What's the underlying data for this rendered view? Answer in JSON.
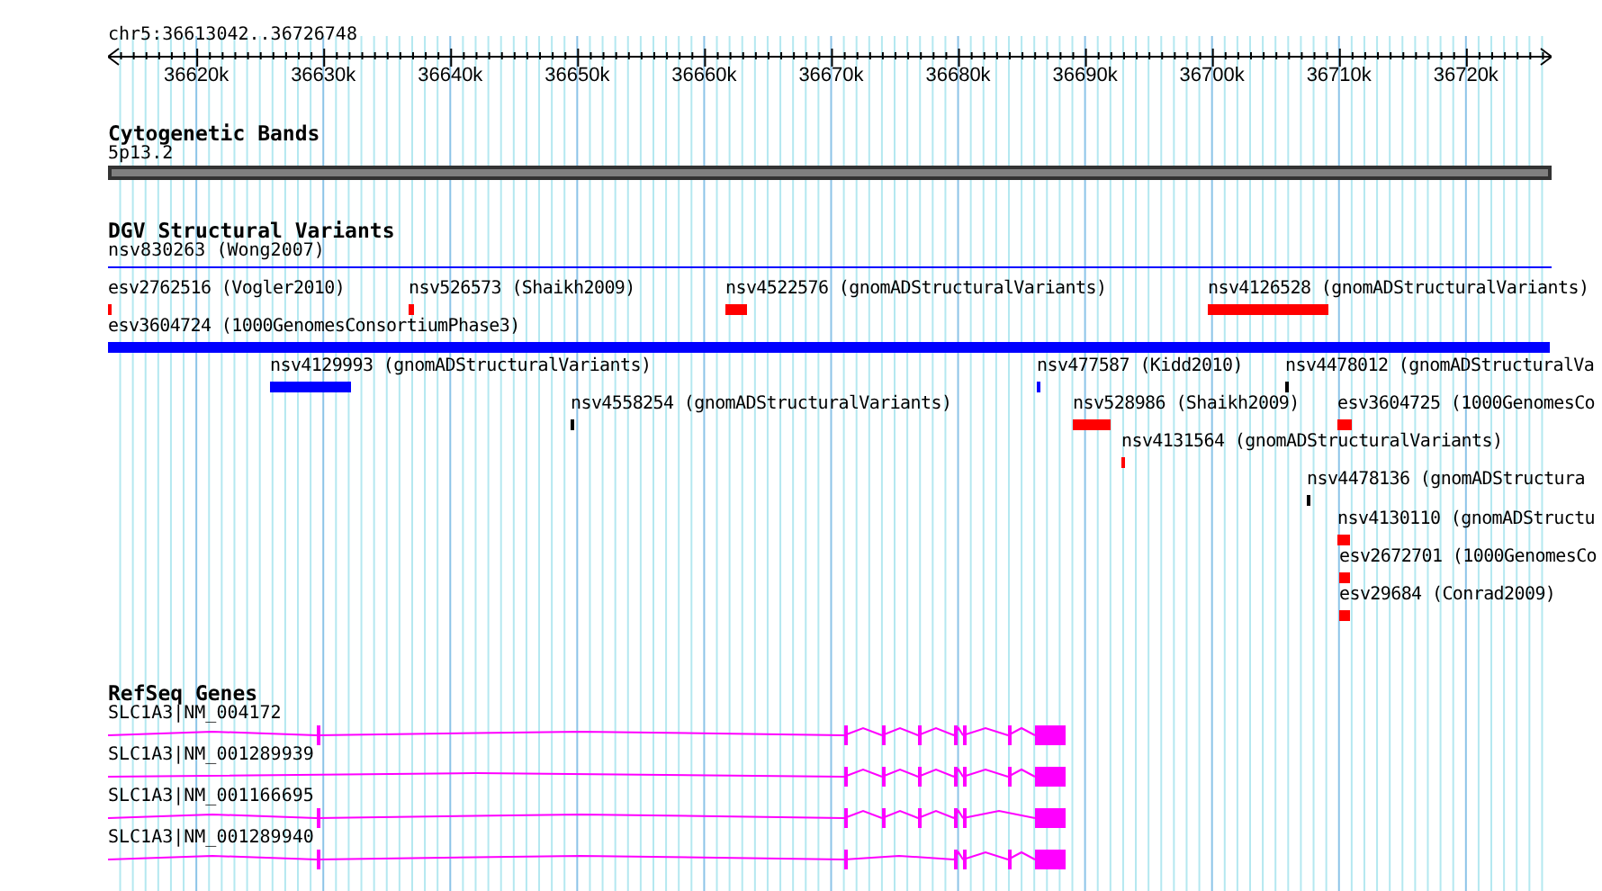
{
  "ruler": {
    "title": "chr5:36613042..36726748",
    "ticks": [
      "36620k",
      "36630k",
      "36640k",
      "36650k",
      "36660k",
      "36670k",
      "36680k",
      "36690k",
      "36700k",
      "36710k",
      "36720k"
    ]
  },
  "tracks": [
    {
      "kind": "bands",
      "title": "Cytogenetic Bands",
      "label": "5p13.2"
    },
    {
      "kind": "variants",
      "title": "DGV Structural Variants",
      "summary": "nsv830263 (Wong2007)",
      "features": [
        {
          "label": "esv2762516 (Vogler2010)",
          "color": "#ff0000"
        },
        {
          "label": "nsv526573 (Shaikh2009)",
          "color": "#ff0000"
        },
        {
          "label": "nsv4522576 (gnomADStructuralVariants)",
          "color": "#ff0000"
        },
        {
          "label": "nsv4126528 (gnomADStructuralVariants)",
          "color": "#ff0000"
        },
        {
          "label": "esv3604724 (1000GenomesConsortiumPhase3)",
          "color": "#0000ff"
        },
        {
          "label": "nsv4129993 (gnomADStructuralVariants)",
          "color": "#0000ff"
        },
        {
          "label": "nsv477587 (Kidd2010)",
          "color": "#0000ff"
        },
        {
          "label": "nsv4478012 (gnomADStructuralVa",
          "color": "#000000"
        },
        {
          "label": "nsv4558254 (gnomADStructuralVariants)",
          "color": "#000000"
        },
        {
          "label": "nsv528986 (Shaikh2009)",
          "color": "#ff0000"
        },
        {
          "label": "esv3604725 (1000GenomesCo",
          "color": "#ff0000"
        },
        {
          "label": "nsv4131564 (gnomADStructuralVariants)",
          "color": "#ff0000"
        },
        {
          "label": "nsv4478136 (gnomADStructura",
          "color": "#000000"
        },
        {
          "label": "nsv4130110 (gnomADStructu",
          "color": "#ff0000"
        },
        {
          "label": "esv2672701 (1000GenomesCo",
          "color": "#ff0000"
        },
        {
          "label": "esv29684 (Conrad2009)",
          "color": "#ff0000"
        }
      ]
    },
    {
      "kind": "genes",
      "title": "RefSeq Genes",
      "genes": [
        {
          "label": "SLC1A3|NM_004172"
        },
        {
          "label": "SLC1A3|NM_001289939"
        },
        {
          "label": "SLC1A3|NM_001166695"
        },
        {
          "label": "SLC1A3|NM_001289940"
        }
      ]
    }
  ]
}
